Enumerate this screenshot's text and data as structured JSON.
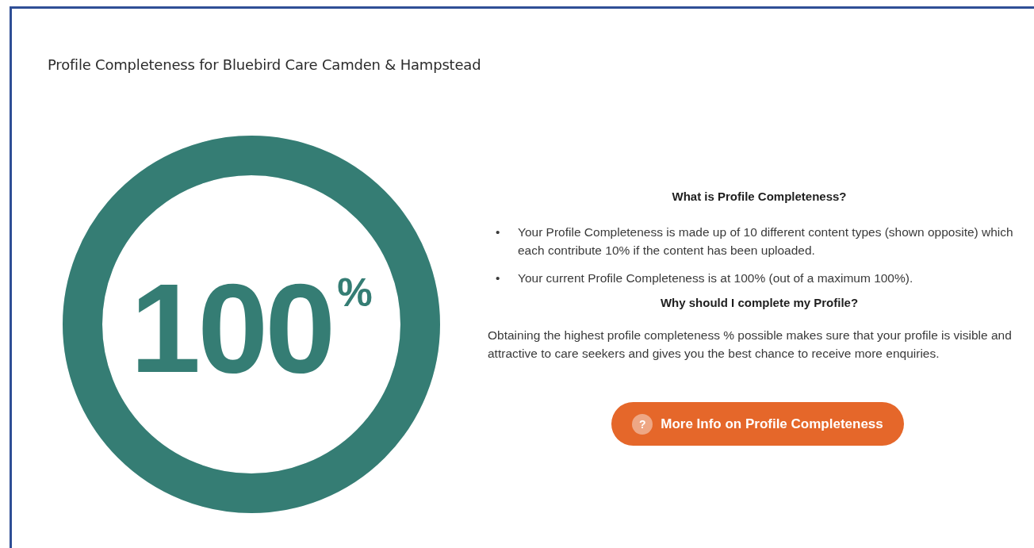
{
  "title": "Profile Completeness for Bluebird Care Camden & Hampstead",
  "gauge": {
    "value": "100",
    "unit": "%",
    "level": 1
  },
  "info": {
    "heading": "What is Profile Completeness?",
    "marker": "•",
    "bullets": [
      "Your Profile Completeness is made up of 10 different content types (shown opposite) which each contribute 10% if the content has been uploaded.",
      "Your current Profile Completeness is at 100% (out of a maximum 100%)."
    ],
    "subheading": "Why should I complete my Profile?",
    "paragraph": "Obtaining the highest profile completeness % possible makes sure that your profile is visible and attractive to care seekers and gives you the best chance to receive more enquiries.",
    "button": {
      "icon": "?",
      "label": "More Info on Profile Completeness"
    }
  }
}
